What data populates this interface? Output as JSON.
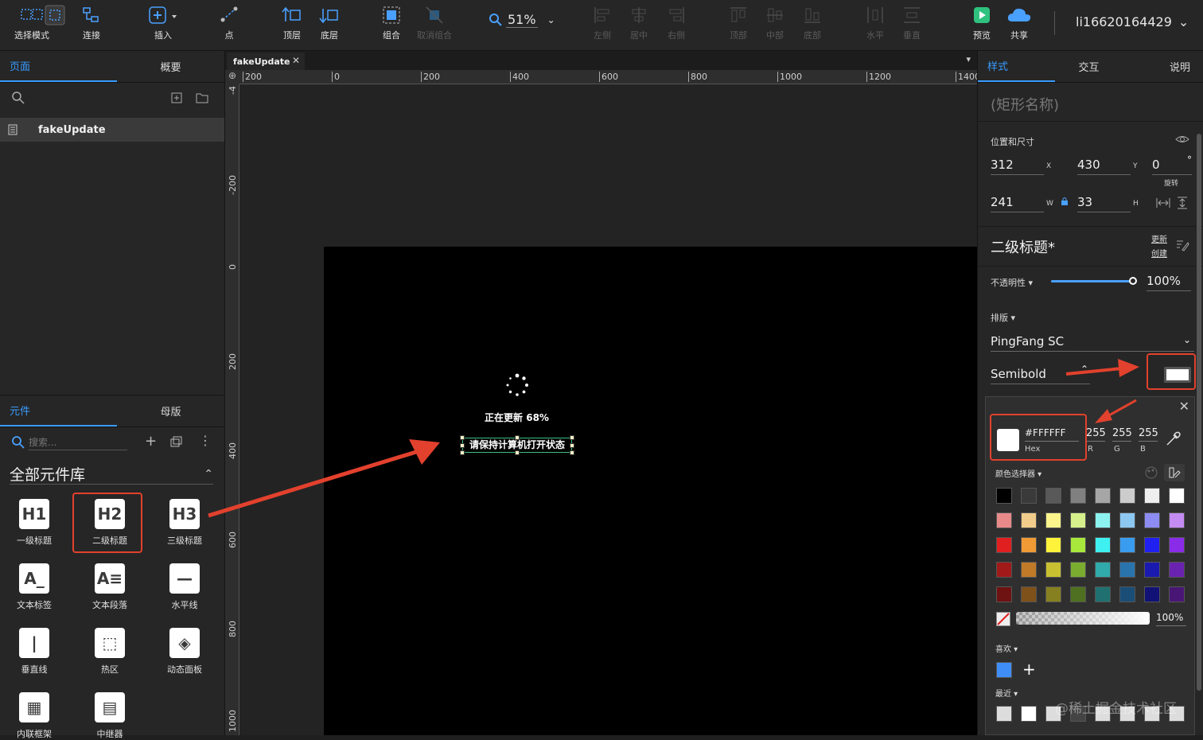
{
  "toolbar": {
    "items": [
      {
        "label": "选择模式",
        "icon": "select-mode-icon"
      },
      {
        "label": "连接",
        "icon": "connect-icon"
      },
      {
        "label": "插入",
        "icon": "insert-icon"
      },
      {
        "label": "点",
        "icon": "point-icon"
      },
      {
        "label": "顶层",
        "icon": "bring-to-front-icon"
      },
      {
        "label": "底层",
        "icon": "send-to-back-icon"
      },
      {
        "label": "组合",
        "icon": "group-icon"
      },
      {
        "label": "取消组合",
        "icon": "ungroup-icon"
      },
      {
        "label": "左侧",
        "icon": "align-left-icon"
      },
      {
        "label": "居中",
        "icon": "align-center-icon"
      },
      {
        "label": "右侧",
        "icon": "align-right-icon"
      },
      {
        "label": "顶部",
        "icon": "align-top-icon"
      },
      {
        "label": "中部",
        "icon": "align-middle-icon"
      },
      {
        "label": "底部",
        "icon": "align-bottom-icon"
      },
      {
        "label": "水平",
        "icon": "distribute-horizontal-icon"
      },
      {
        "label": "垂直",
        "icon": "distribute-vertical-icon"
      },
      {
        "label": "预览",
        "icon": "preview-icon"
      },
      {
        "label": "共享",
        "icon": "share-cloud-icon"
      }
    ],
    "zoom": "51%",
    "user": "li16620164429"
  },
  "left": {
    "tabs": [
      "页面",
      "概要"
    ],
    "pages": [
      "fakeUpdate"
    ],
    "lib_tabs": [
      "元件",
      "母版"
    ],
    "search_placeholder": "搜索...",
    "library_title": "全部元件库",
    "widgets": [
      {
        "label": "一级标题",
        "glyph": "H1"
      },
      {
        "label": "二级标题",
        "glyph": "H2"
      },
      {
        "label": "三级标题",
        "glyph": "H3"
      },
      {
        "label": "文本标签",
        "glyph": "A_"
      },
      {
        "label": "文本段落",
        "glyph": "A≡"
      },
      {
        "label": "水平线",
        "glyph": "—"
      },
      {
        "label": "垂直线",
        "glyph": "|"
      },
      {
        "label": "热区",
        "glyph": "⬚"
      },
      {
        "label": "动态面板",
        "glyph": "◈"
      },
      {
        "label": "内联框架",
        "glyph": "▦"
      },
      {
        "label": "中继器",
        "glyph": "▤"
      }
    ]
  },
  "canvas": {
    "doc_tab": "fakeUpdate",
    "hruler_labels": [
      "200",
      "0",
      "200",
      "400",
      "600",
      "800",
      "1000",
      "1200",
      "1400"
    ],
    "vruler_labels": [
      "-4",
      "-200",
      "0",
      "200",
      "400",
      "600",
      "800",
      "1000"
    ],
    "update_text": "正在更新 68%",
    "keep_text": "请保持计算机打开状态"
  },
  "right": {
    "tabs": [
      "样式",
      "交互",
      "说明"
    ],
    "shape_name_placeholder": "(矩形名称)",
    "pos_size_label": "位置和尺寸",
    "x": "312",
    "x_label": "X",
    "y": "430",
    "y_label": "Y",
    "rotation": "0",
    "rotation_unit": "°",
    "rotation_label": "旋转",
    "w": "241",
    "w_label": "W",
    "h": "33",
    "h_label": "H",
    "style_name": "二级标题*",
    "update_label": "更新",
    "create_label": "创建",
    "opacity_label": "不透明性 ▾",
    "opacity_value": "100%",
    "opacity": 1.0,
    "typography_label": "排版 ▾",
    "font_name": "PingFang SC",
    "font_weight": "Semibold"
  },
  "colorpicker": {
    "hex": "#FFFFFF",
    "hex_label": "Hex",
    "r": "255",
    "g": "255",
    "b": "255",
    "r_label": "R",
    "g_label": "G",
    "b_label": "B",
    "picker_label": "颜色选择器 ▾",
    "alpha": "100%",
    "favorites_label": "喜欢 ▾",
    "recent_label": "最近 ▾",
    "favorite_color": "#3f8ef7",
    "swatches": [
      [
        "#000000",
        "#3a3a3a",
        "#595959",
        "#808080",
        "#a6a6a6",
        "#cccccc",
        "#eeeeee",
        "#ffffff"
      ],
      [
        "#e88a8a",
        "#f2cc8a",
        "#fcf58c",
        "#d6f08c",
        "#8cf2f0",
        "#8cc8f2",
        "#8c8cf2",
        "#c48cf2"
      ],
      [
        "#e02020",
        "#ef9a34",
        "#fff23a",
        "#a8e83c",
        "#3ef0f0",
        "#3a9cee",
        "#2020f0",
        "#8a2be8"
      ],
      [
        "#a01a1a",
        "#c07a28",
        "#c8c030",
        "#7aac30",
        "#30aaaa",
        "#2a74ae",
        "#1a1ab0",
        "#6a22b0"
      ],
      [
        "#6e1212",
        "#7e501a",
        "#868020",
        "#4e7020",
        "#207070",
        "#1a4e76",
        "#121276",
        "#4a1676"
      ]
    ],
    "recent_colors": [
      "#dddddd",
      "#ffffff",
      "#dddddd",
      "#444444",
      "#dddddd",
      "#dddddd",
      "#dddddd",
      "#dddddd"
    ]
  },
  "watermark": "@稀土掘金技术社区"
}
